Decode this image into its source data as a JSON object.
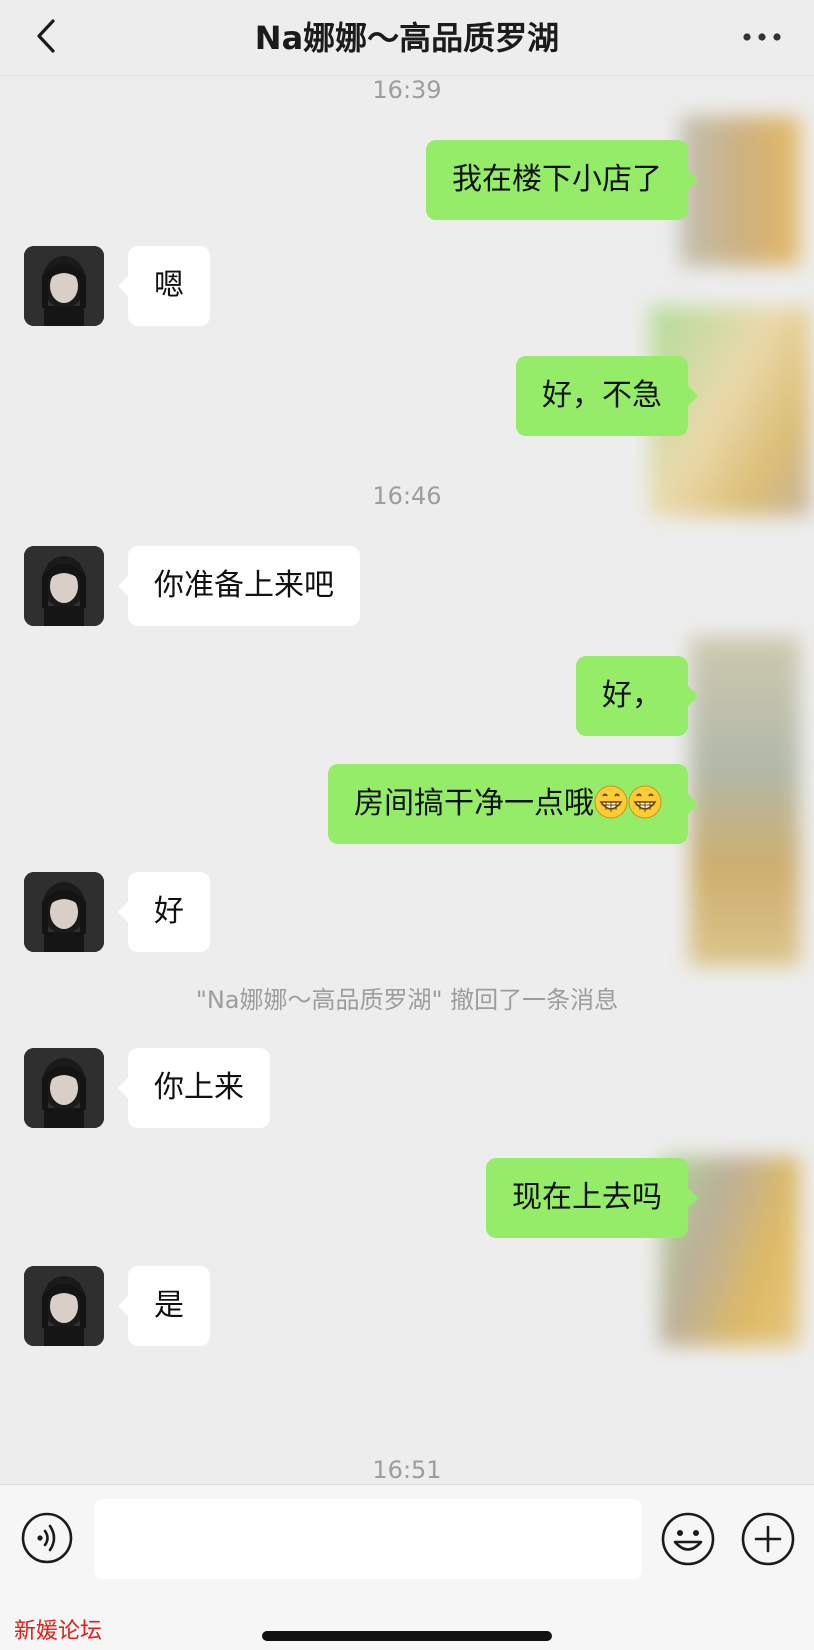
{
  "header": {
    "title": "Na娜娜～高品质罗湖"
  },
  "times": [
    "16:39",
    "16:46",
    "16:51"
  ],
  "messages": {
    "m1": "我在楼下小店了",
    "m2": "嗯",
    "m3": "好，不急",
    "m4": "你准备上来吧",
    "m5": "好，",
    "m6": "房间搞干净一点哦",
    "m7": "好",
    "m8": "你上来",
    "m9": "现在上去吗",
    "m10": "是"
  },
  "recall_notice": "\"Na娜娜～高品质罗湖\" 撤回了一条消息",
  "input": {
    "value": "",
    "placeholder": ""
  },
  "watermark": "新媛论坛",
  "icons": {
    "back": "chevron-left-icon",
    "more": "more-dots-icon",
    "voice": "voice-icon",
    "emoji": "emoji-icon",
    "plus": "plus-icon"
  },
  "colors": {
    "background": "#ededed",
    "bubble_out": "#95ec69",
    "bubble_in": "#ffffff",
    "watermark": "#d9231b"
  }
}
